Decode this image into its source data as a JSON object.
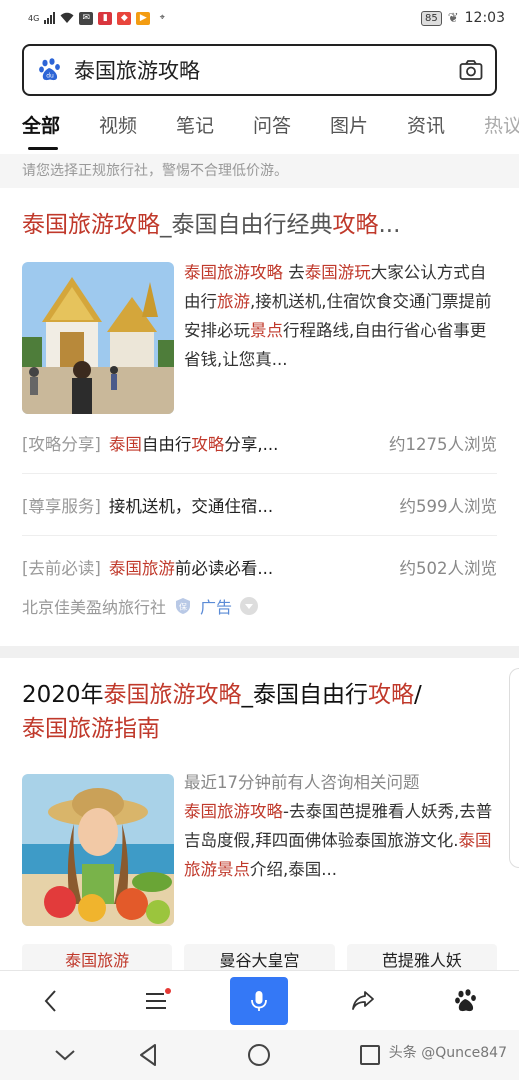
{
  "status_bar": {
    "network": "4G",
    "battery": "85",
    "time": "12:03",
    "icons": [
      "signal-icon",
      "wifi-icon",
      "mail-icon",
      "recorder-icon",
      "app-icon",
      "video-app-icon",
      "location-icon",
      "leaf-icon"
    ]
  },
  "search": {
    "query": "泰国旅游攻略",
    "logo_icon": "baidu-paw-icon",
    "camera_icon": "camera-icon"
  },
  "tabs": [
    "全部",
    "视频",
    "笔记",
    "问答",
    "图片",
    "资讯",
    "热议"
  ],
  "active_tab": "全部",
  "notice": "请您选择正规旅行社，警惕不合理低价游。",
  "result1": {
    "title_red": "泰国旅游攻略",
    "title_rest": "_泰国自由行经典",
    "title_red2": "攻略",
    "title_ellipsis": "...",
    "snippet_p1": "泰国旅游攻略",
    "snippet_p2": " 去",
    "snippet_p3": "泰国游玩",
    "snippet_p4": "大家公认方式自由行",
    "snippet_p5": "旅游",
    "snippet_p6": ",接机送机,住宿饮食交通门票提前安排必玩",
    "snippet_p7": "景点",
    "snippet_p8": "行程路线,自由行省心省事更省钱,让您真...",
    "sub_rows": [
      {
        "tag": "[攻略分享]",
        "red": "泰国",
        "mid": "自由行",
        "red2": "攻略",
        "rest": "分享,...",
        "count": "约1275人浏览"
      },
      {
        "tag": "[尊享服务]",
        "red": "",
        "mid": "接机送机，交通住宿...",
        "red2": "",
        "rest": "",
        "count": "约599人浏览"
      },
      {
        "tag": "[去前必读]",
        "red": "泰国旅游",
        "mid": "前必读必看...",
        "red2": "",
        "rest": "",
        "count": "约502人浏览"
      }
    ],
    "source": "北京佳美盈纳旅行社",
    "ad": "广告"
  },
  "result2": {
    "title_a": "2020年",
    "title_red": "泰国旅游攻略",
    "title_b": "_泰国自由行",
    "title_red2": "攻略",
    "title_c": "/",
    "title_line2": "泰国旅游指南",
    "meta": "最近17分钟前有人咨询相关问题",
    "snippet_p1": "泰国旅游攻略",
    "snippet_p2": "-去泰国芭提雅看人妖秀,去普吉岛度假,拜四面佛体验泰国旅游文化.",
    "snippet_p3": "泰国旅游景点",
    "snippet_p4": "介绍,泰国...",
    "chips": [
      "泰国旅游",
      "曼谷大皇宫",
      "芭提雅人妖"
    ]
  },
  "toolbar": {
    "icons": [
      "back-icon",
      "menu-icon",
      "mic-icon",
      "share-icon",
      "baidu-paw-icon"
    ]
  },
  "navbar": {
    "icons": [
      "collapse-icon",
      "back-triangle-icon",
      "home-circle-icon",
      "recents-square-icon"
    ]
  },
  "watermark": "头条 @Qunce847",
  "colors": {
    "accent_red": "#c0392b",
    "mic_blue": "#3478f6",
    "ad_blue": "#5b8bd6"
  }
}
